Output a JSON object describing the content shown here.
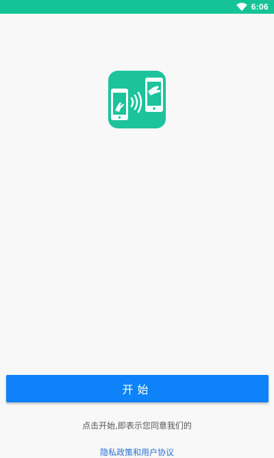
{
  "status_bar": {
    "time": "6:06",
    "wifi_icon": "wifi-icon",
    "background_color": "#14c497"
  },
  "logo": {
    "icon": "phone-transfer-logo-icon",
    "color": "#1cc39b"
  },
  "start_button": {
    "label": "开始",
    "color": "#0e82f8"
  },
  "consent": {
    "text": "点击开始,即表示您同意我们的",
    "link_text": "隐私政策和用户协议",
    "link_color": "#2a6fd6"
  }
}
